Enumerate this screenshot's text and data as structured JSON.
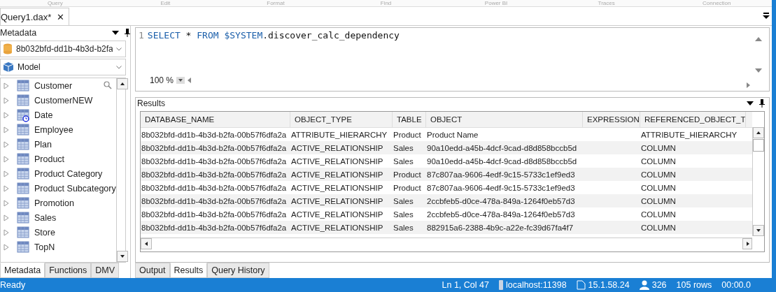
{
  "ribbon_groups": [
    "Query",
    "Edit",
    "Format",
    "Find",
    "Power BI",
    "Traces",
    "Connection"
  ],
  "document_tab": {
    "label": "Query1.dax*",
    "close": "✕"
  },
  "metadata_panel": {
    "title": "Metadata",
    "database": "8b032bfd-dd1b-4b3d-b2fa",
    "model": "Model",
    "tables": [
      {
        "name": "Customer",
        "kind": "table"
      },
      {
        "name": "CustomerNEW",
        "kind": "table"
      },
      {
        "name": "Date",
        "kind": "date"
      },
      {
        "name": "Employee",
        "kind": "table"
      },
      {
        "name": "Plan",
        "kind": "table"
      },
      {
        "name": "Product",
        "kind": "table"
      },
      {
        "name": "Product Category",
        "kind": "table"
      },
      {
        "name": "Product Subcategory",
        "kind": "table"
      },
      {
        "name": "Promotion",
        "kind": "table"
      },
      {
        "name": "Sales",
        "kind": "table"
      },
      {
        "name": "Store",
        "kind": "table"
      },
      {
        "name": "TopN",
        "kind": "table"
      }
    ],
    "tabs": [
      {
        "label": "Metadata",
        "selected": true
      },
      {
        "label": "Functions",
        "selected": false
      },
      {
        "label": "DMV",
        "selected": false
      }
    ]
  },
  "editor": {
    "line_number": "1",
    "tokens": [
      {
        "text": "SELECT",
        "kind": "keyword"
      },
      {
        "text": " * ",
        "kind": "plain"
      },
      {
        "text": "FROM",
        "kind": "keyword"
      },
      {
        "text": " $SYSTEM",
        "kind": "keyword"
      },
      {
        "text": ".discover_calc_dependency",
        "kind": "plain"
      }
    ],
    "zoom": "100 %"
  },
  "results": {
    "title": "Results",
    "columns": [
      "DATABASE_NAME",
      "OBJECT_TYPE",
      "TABLE",
      "OBJECT",
      "EXPRESSION",
      "REFERENCED_OBJECT_T"
    ],
    "rows": [
      [
        "8b032bfd-dd1b-4b3d-b2fa-00b57f6dfa2a",
        "ATTRIBUTE_HIERARCHY",
        "Product",
        "Product Name",
        "",
        "ATTRIBUTE_HIERARCHY"
      ],
      [
        "8b032bfd-dd1b-4b3d-b2fa-00b57f6dfa2a",
        "ACTIVE_RELATIONSHIP",
        "Sales",
        "90a10edd-a45b-4dcf-9cad-d8d858bccb5d",
        "",
        "COLUMN"
      ],
      [
        "8b032bfd-dd1b-4b3d-b2fa-00b57f6dfa2a",
        "ACTIVE_RELATIONSHIP",
        "Sales",
        "90a10edd-a45b-4dcf-9cad-d8d858bccb5d",
        "",
        "COLUMN"
      ],
      [
        "8b032bfd-dd1b-4b3d-b2fa-00b57f6dfa2a",
        "ACTIVE_RELATIONSHIP",
        "Product",
        "87c807aa-9606-4edf-9c15-5733c1ef9ed3",
        "",
        "COLUMN"
      ],
      [
        "8b032bfd-dd1b-4b3d-b2fa-00b57f6dfa2a",
        "ACTIVE_RELATIONSHIP",
        "Product",
        "87c807aa-9606-4edf-9c15-5733c1ef9ed3",
        "",
        "COLUMN"
      ],
      [
        "8b032bfd-dd1b-4b3d-b2fa-00b57f6dfa2a",
        "ACTIVE_RELATIONSHIP",
        "Sales",
        "2ccbfeb5-d0ce-478a-849a-1264f0eb57d3",
        "",
        "COLUMN"
      ],
      [
        "8b032bfd-dd1b-4b3d-b2fa-00b57f6dfa2a",
        "ACTIVE_RELATIONSHIP",
        "Sales",
        "2ccbfeb5-d0ce-478a-849a-1264f0eb57d3",
        "",
        "COLUMN"
      ],
      [
        "8b032bfd-dd1b-4b3d-b2fa-00b57f6dfa2a",
        "ACTIVE_RELATIONSHIP",
        "Sales",
        "882915a6-2388-4b9c-a22e-fc39d67fa4f7",
        "",
        "COLUMN"
      ]
    ],
    "tabs": [
      {
        "label": "Output",
        "selected": false
      },
      {
        "label": "Results",
        "selected": true
      },
      {
        "label": "Query History",
        "selected": false
      }
    ]
  },
  "status_bar": {
    "state": "Ready",
    "position": "Ln 1, Col 47",
    "server": "localhost:11398",
    "version": "15.1.58.24",
    "spid": "326",
    "rows": "105 rows",
    "duration": "00:00.0"
  }
}
